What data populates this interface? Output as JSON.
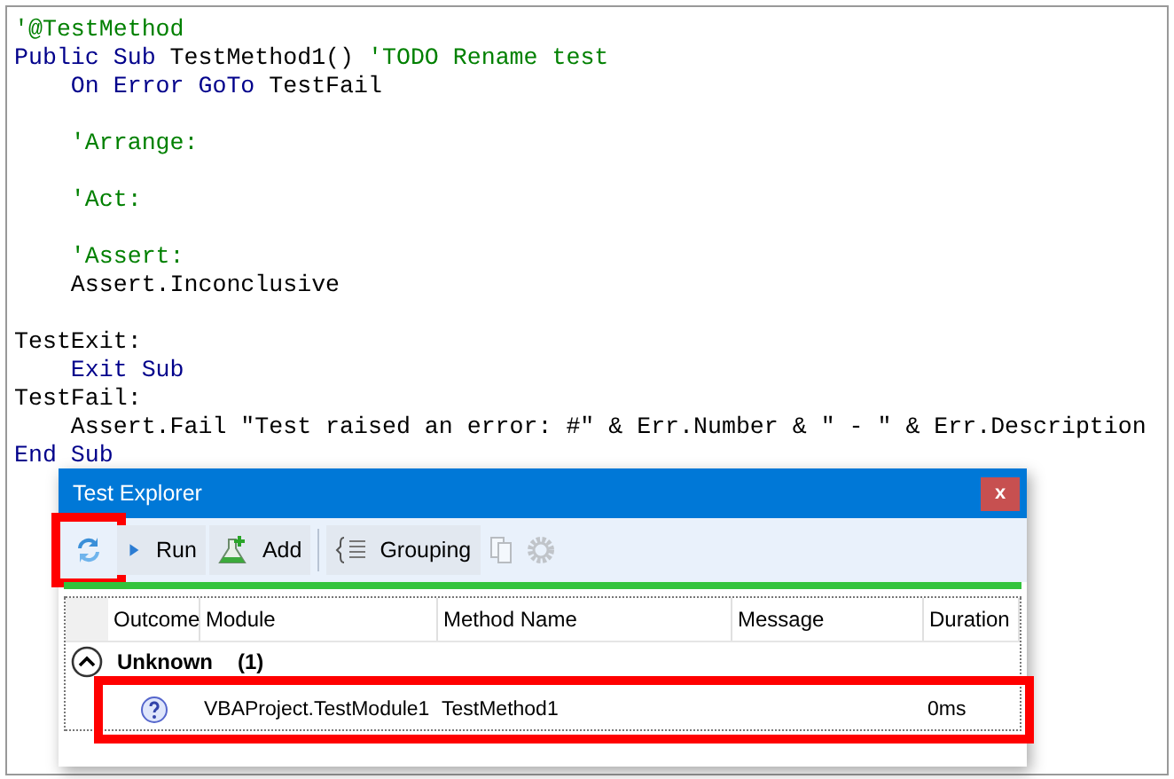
{
  "code_blocks": [
    [
      [
        {
          "kind": "comment",
          "text": "'@TestMethod"
        }
      ],
      [
        {
          "kind": "keyword",
          "text": "Public Sub "
        },
        {
          "kind": "plain",
          "text": "TestMethod1() "
        },
        {
          "kind": "comment",
          "text": "'TODO Rename test"
        }
      ],
      [
        {
          "kind": "keyword",
          "text": "    On Error GoTo "
        },
        {
          "kind": "plain",
          "text": "TestFail"
        }
      ]
    ],
    [
      [
        {
          "kind": "comment",
          "text": "    'Arrange:"
        }
      ]
    ],
    [
      [
        {
          "kind": "comment",
          "text": "    'Act:"
        }
      ]
    ],
    [
      [
        {
          "kind": "comment",
          "text": "    'Assert:"
        }
      ],
      [
        {
          "kind": "plain",
          "text": "    Assert.Inconclusive"
        }
      ]
    ],
    [
      [
        {
          "kind": "plain",
          "text": "TestExit:"
        }
      ],
      [
        {
          "kind": "keyword",
          "text": "    Exit Sub"
        }
      ],
      [
        {
          "kind": "plain",
          "text": "TestFail:"
        }
      ],
      [
        {
          "kind": "plain",
          "text": "    Assert.Fail \"Test raised an error: #\" & Err.Number & \" - \" & Err.Description"
        }
      ],
      [
        {
          "kind": "keyword",
          "text": "End Sub"
        }
      ]
    ]
  ],
  "test_explorer": {
    "title": "Test Explorer",
    "close": "x",
    "toolbar_groups": [
      [
        {
          "kind": "refresh",
          "highlighted": true,
          "disabled": false
        },
        {
          "kind": "run",
          "label": "Run",
          "highlighted": false,
          "disabled": false
        },
        {
          "kind": "add",
          "label": "Add",
          "highlighted": false,
          "disabled": false
        }
      ],
      [
        {
          "kind": "grouping",
          "label": "Grouping",
          "highlighted": false,
          "disabled": false
        },
        {
          "kind": "copy",
          "highlighted": false,
          "disabled": true
        },
        {
          "kind": "settings",
          "highlighted": false,
          "disabled": true
        }
      ]
    ],
    "progress": {
      "level": 1
    },
    "columns": [
      "Outcome",
      "Module",
      "Method Name",
      "Message",
      "Duration"
    ],
    "groups": [
      {
        "label": "Unknown",
        "count": "(1)",
        "expanded": true,
        "rows": [
          {
            "kind": "unknown",
            "module": "VBAProject.TestModule1",
            "method": "TestMethod1",
            "duration": "0ms",
            "highlighted": true
          }
        ]
      }
    ]
  }
}
